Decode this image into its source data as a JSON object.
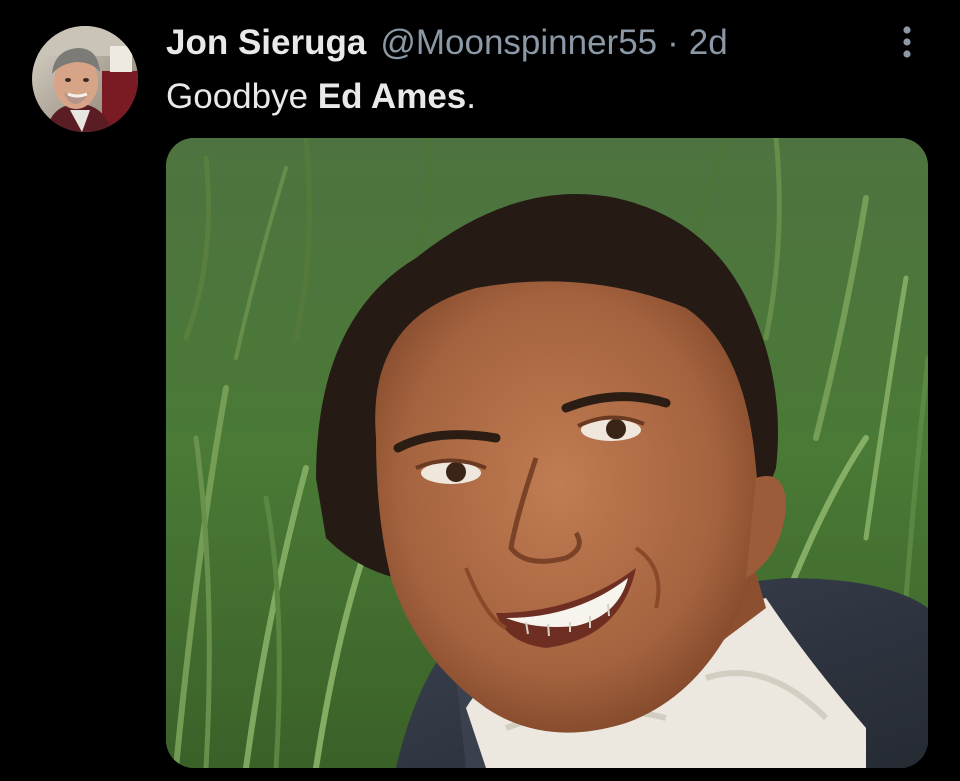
{
  "tweet": {
    "author": {
      "display_name": "Jon Sieruga",
      "handle": "@Moonspinner55",
      "avatar_description": "user-avatar"
    },
    "separator": "·",
    "timestamp": "2d",
    "text_plain": "Goodbye ",
    "text_bold": "Ed Ames",
    "text_end": ".",
    "more_icon": "more-vertical-icon",
    "media": {
      "kind": "photo"
    }
  },
  "colors": {
    "background": "#000000",
    "primary_text": "#e7e9ea",
    "secondary_text": "#8b98a5"
  }
}
